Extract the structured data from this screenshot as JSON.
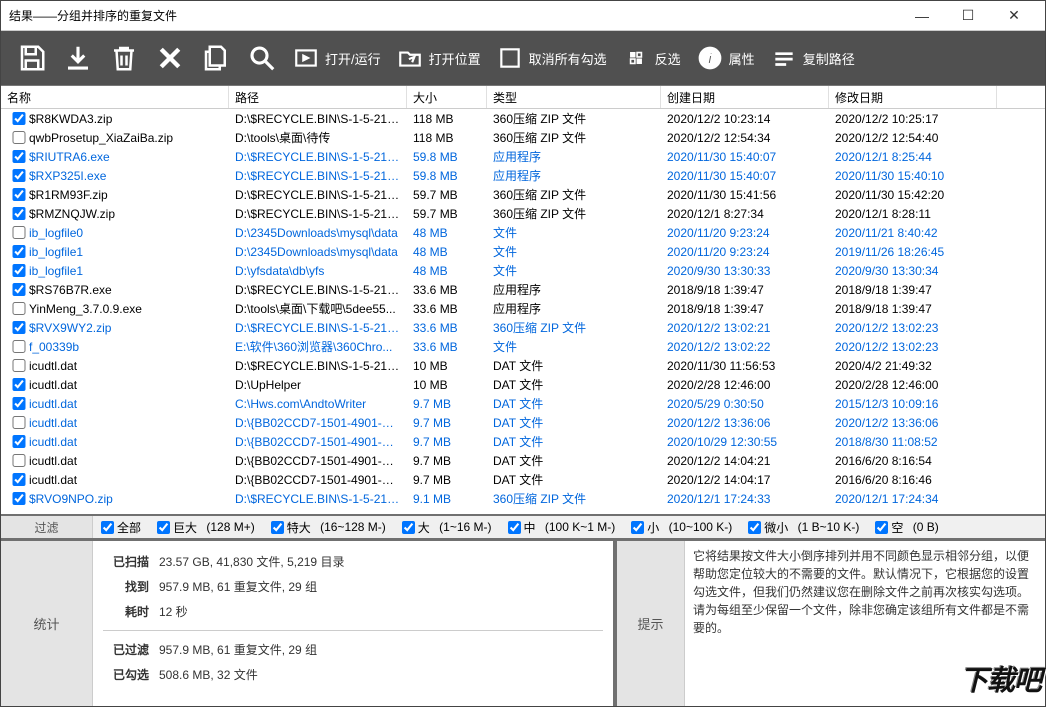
{
  "window": {
    "title": "结果——分组并排序的重复文件"
  },
  "toolbar": {
    "open_run": "打开/运行",
    "open_location": "打开位置",
    "uncheck_all": "取消所有勾选",
    "invert": "反选",
    "properties": "属性",
    "copy_path": "复制路径"
  },
  "columns": {
    "name": "名称",
    "path": "路径",
    "size": "大小",
    "type": "类型",
    "created": "创建日期",
    "modified": "修改日期"
  },
  "rows": [
    {
      "chk": true,
      "blue": false,
      "name": "$R8KWDA3.zip",
      "path": "D:\\$RECYCLE.BIN\\S-1-5-21-21...",
      "size": "118 MB",
      "type": "360压缩 ZIP 文件",
      "created": "2020/12/2 10:23:14",
      "modified": "2020/12/2 10:25:17"
    },
    {
      "chk": false,
      "blue": false,
      "name": "qwbProsetup_XiaZaiBa.zip",
      "path": "D:\\tools\\桌面\\待传",
      "size": "118 MB",
      "type": "360压缩 ZIP 文件",
      "created": "2020/12/2 12:54:34",
      "modified": "2020/12/2 12:54:40"
    },
    {
      "chk": true,
      "blue": true,
      "name": "$RIUTRA6.exe",
      "path": "D:\\$RECYCLE.BIN\\S-1-5-21-21...",
      "size": "59.8 MB",
      "type": "应用程序",
      "created": "2020/11/30 15:40:07",
      "modified": "2020/12/1 8:25:44"
    },
    {
      "chk": true,
      "blue": true,
      "name": "$RXP325I.exe",
      "path": "D:\\$RECYCLE.BIN\\S-1-5-21-21...",
      "size": "59.8 MB",
      "type": "应用程序",
      "created": "2020/11/30 15:40:07",
      "modified": "2020/11/30 15:40:10"
    },
    {
      "chk": true,
      "blue": false,
      "name": "$R1RM93F.zip",
      "path": "D:\\$RECYCLE.BIN\\S-1-5-21-21...",
      "size": "59.7 MB",
      "type": "360压缩 ZIP 文件",
      "created": "2020/11/30 15:41:56",
      "modified": "2020/11/30 15:42:20"
    },
    {
      "chk": true,
      "blue": false,
      "name": "$RMZNQJW.zip",
      "path": "D:\\$RECYCLE.BIN\\S-1-5-21-21...",
      "size": "59.7 MB",
      "type": "360压缩 ZIP 文件",
      "created": "2020/12/1 8:27:34",
      "modified": "2020/12/1 8:28:11"
    },
    {
      "chk": false,
      "blue": true,
      "name": "ib_logfile0",
      "path": "D:\\2345Downloads\\mysql\\data",
      "size": "48 MB",
      "type": "文件",
      "created": "2020/11/20 9:23:24",
      "modified": "2020/11/21 8:40:42"
    },
    {
      "chk": true,
      "blue": true,
      "name": "ib_logfile1",
      "path": "D:\\2345Downloads\\mysql\\data",
      "size": "48 MB",
      "type": "文件",
      "created": "2020/11/20 9:23:24",
      "modified": "2019/11/26 18:26:45"
    },
    {
      "chk": true,
      "blue": true,
      "name": "ib_logfile1",
      "path": "D:\\yfsdata\\db\\yfs",
      "size": "48 MB",
      "type": "文件",
      "created": "2020/9/30 13:30:33",
      "modified": "2020/9/30 13:30:34"
    },
    {
      "chk": true,
      "blue": false,
      "name": "$RS76B7R.exe",
      "path": "D:\\$RECYCLE.BIN\\S-1-5-21-21...",
      "size": "33.6 MB",
      "type": "应用程序",
      "created": "2018/9/18 1:39:47",
      "modified": "2018/9/18 1:39:47"
    },
    {
      "chk": false,
      "blue": false,
      "name": "YinMeng_3.7.0.9.exe",
      "path": "D:\\tools\\桌面\\下载吧\\5dee55...",
      "size": "33.6 MB",
      "type": "应用程序",
      "created": "2018/9/18 1:39:47",
      "modified": "2018/9/18 1:39:47"
    },
    {
      "chk": true,
      "blue": true,
      "name": "$RVX9WY2.zip",
      "path": "D:\\$RECYCLE.BIN\\S-1-5-21-21...",
      "size": "33.6 MB",
      "type": "360压缩 ZIP 文件",
      "created": "2020/12/2 13:02:21",
      "modified": "2020/12/2 13:02:23"
    },
    {
      "chk": false,
      "blue": true,
      "name": "f_00339b",
      "path": "E:\\软件\\360浏览器\\360Chro...",
      "size": "33.6 MB",
      "type": "文件",
      "created": "2020/12/2 13:02:22",
      "modified": "2020/12/2 13:02:23"
    },
    {
      "chk": false,
      "blue": false,
      "name": "icudtl.dat",
      "path": "D:\\$RECYCLE.BIN\\S-1-5-21-21...",
      "size": "10 MB",
      "type": "DAT 文件",
      "created": "2020/11/30 11:56:53",
      "modified": "2020/4/2 21:49:32"
    },
    {
      "chk": true,
      "blue": false,
      "name": "icudtl.dat",
      "path": "D:\\UpHelper",
      "size": "10 MB",
      "type": "DAT 文件",
      "created": "2020/2/28 12:46:00",
      "modified": "2020/2/28 12:46:00"
    },
    {
      "chk": true,
      "blue": true,
      "name": "icudtl.dat",
      "path": "C:\\Hws.com\\AndtoWriter",
      "size": "9.7 MB",
      "type": "DAT 文件",
      "created": "2020/5/29 0:30:50",
      "modified": "2015/12/3 10:09:16"
    },
    {
      "chk": false,
      "blue": true,
      "name": "icudtl.dat",
      "path": "D:\\{BB02CCD7-1501-4901-B5E...",
      "size": "9.7 MB",
      "type": "DAT 文件",
      "created": "2020/12/2 13:36:06",
      "modified": "2020/12/2 13:36:06"
    },
    {
      "chk": true,
      "blue": true,
      "name": "icudtl.dat",
      "path": "D:\\{BB02CCD7-1501-4901-B5E...",
      "size": "9.7 MB",
      "type": "DAT 文件",
      "created": "2020/10/29 12:30:55",
      "modified": "2018/8/30 11:08:52"
    },
    {
      "chk": false,
      "blue": false,
      "name": "icudtl.dat",
      "path": "D:\\{BB02CCD7-1501-4901-B5E...",
      "size": "9.7 MB",
      "type": "DAT 文件",
      "created": "2020/12/2 14:04:21",
      "modified": "2016/6/20 8:16:54"
    },
    {
      "chk": true,
      "blue": false,
      "name": "icudtl.dat",
      "path": "D:\\{BB02CCD7-1501-4901-B5E...",
      "size": "9.7 MB",
      "type": "DAT 文件",
      "created": "2020/12/2 14:04:17",
      "modified": "2016/6/20 8:16:46"
    },
    {
      "chk": true,
      "blue": true,
      "name": "$RVO9NPO.zip",
      "path": "D:\\$RECYCLE.BIN\\S-1-5-21-21...",
      "size": "9.1 MB",
      "type": "360压缩 ZIP 文件",
      "created": "2020/12/1 17:24:33",
      "modified": "2020/12/1 17:24:34"
    }
  ],
  "filter": {
    "label": "过滤",
    "all": "全部",
    "huge": "巨大",
    "huge_hint": "(128 M+)",
    "xl": "特大",
    "xl_hint": "(16~128 M-)",
    "large": "大",
    "large_hint": "(1~16 M-)",
    "medium": "中",
    "medium_hint": "(100 K~1 M-)",
    "small": "小",
    "small_hint": "(10~100 K-)",
    "tiny": "微小",
    "tiny_hint": "(1 B~10 K-)",
    "empty": "空",
    "empty_hint": "(0 B)"
  },
  "stats": {
    "label": "统计",
    "scanned_k": "已扫描",
    "scanned_v": "23.57 GB, 41,830 文件, 5,219 目录",
    "found_k": "找到",
    "found_v": "957.9 MB, 61 重复文件, 29 组",
    "time_k": "耗时",
    "time_v": "12 秒",
    "filtered_k": "已过滤",
    "filtered_v": "957.9 MB, 61 重复文件, 29 组",
    "checked_k": "已勾选",
    "checked_v": "508.6 MB, 32 文件"
  },
  "tips": {
    "label": "提示",
    "text": "它将结果按文件大小倒序排列并用不同颜色显示相邻分组，以便帮助您定位较大的不需要的文件。默认情况下，它根据您的设置勾选文件，但我们仍然建议您在删除文件之前再次核实勾选项。请为每组至少保留一个文件，除非您确定该组所有文件都是不需要的。"
  },
  "watermark": "下载吧"
}
